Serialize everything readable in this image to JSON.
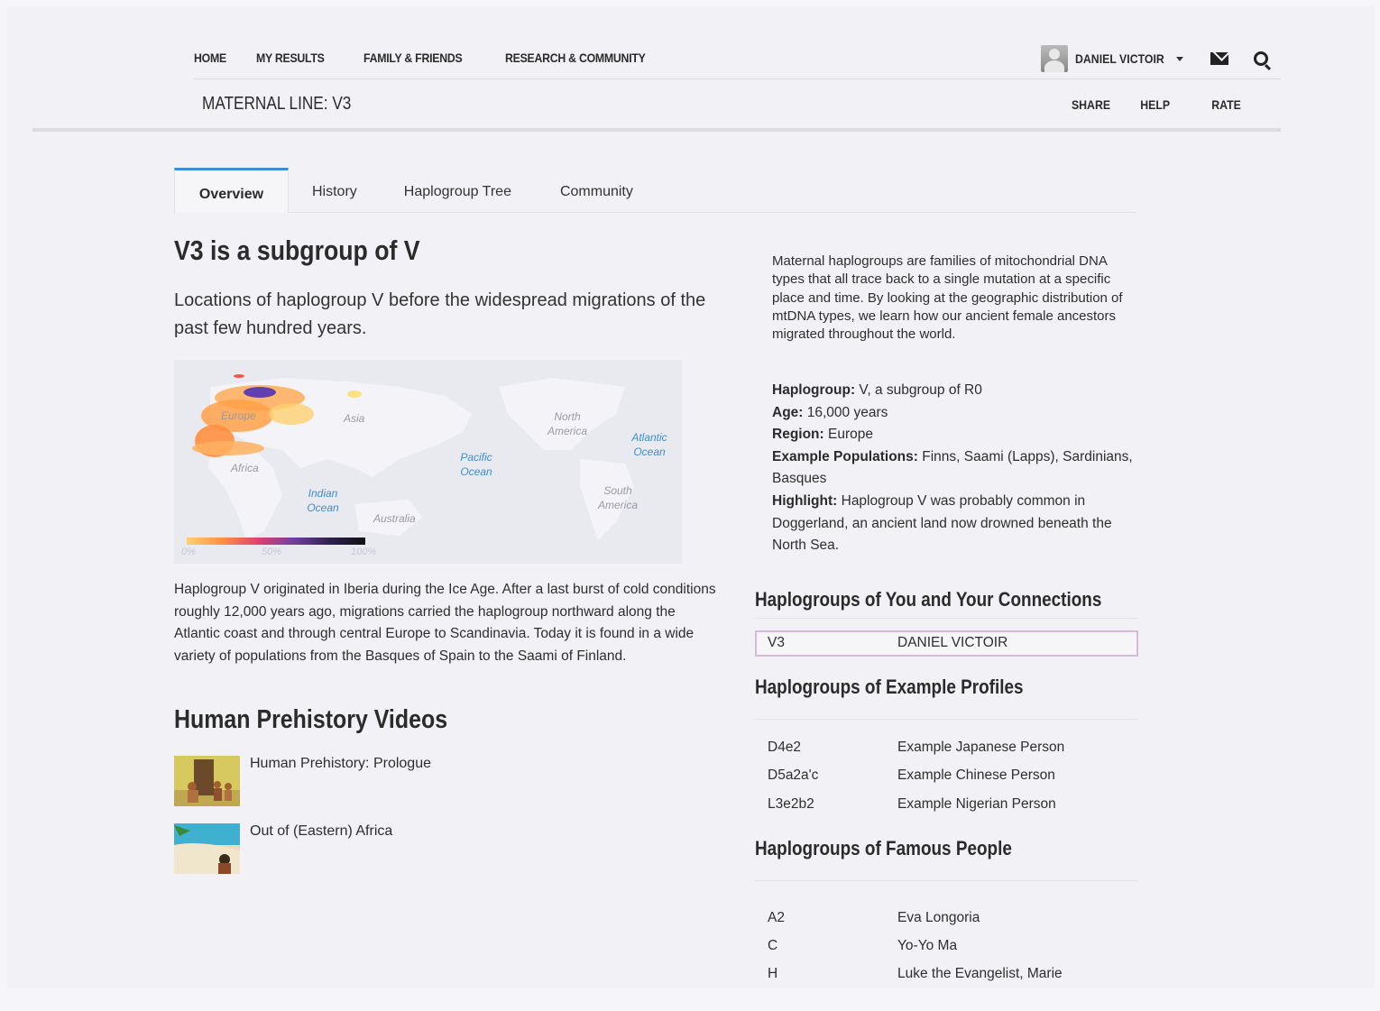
{
  "nav": {
    "items": [
      "HOME",
      "MY RESULTS",
      "FAMILY & FRIENDS",
      "RESEARCH & COMMUNITY"
    ],
    "user_name": "DANIEL VICTOIR"
  },
  "subbar": {
    "title": "MATERNAL LINE: V3",
    "links": [
      "SHARE",
      "HELP",
      "RATE"
    ]
  },
  "tabs": [
    "Overview",
    "History",
    "Haplogroup Tree",
    "Community"
  ],
  "main": {
    "heading": "V3 is a subgroup of V",
    "lead": "Locations of haplogroup V before the widespread migrations of the past few hundred years.",
    "map": {
      "labels": {
        "europe": "Europe",
        "asia": "Asia",
        "africa": "Africa",
        "australia": "Australia",
        "north_america": "North America",
        "south_america": "South America",
        "pacific": "Pacific Ocean",
        "atlantic": "Atlantic Ocean",
        "indian": "Indian Ocean"
      },
      "legend": [
        "0%",
        "50%",
        "100%"
      ]
    },
    "paragraph": "Haplogroup V originated in Iberia during the Ice Age. After a last burst of cold conditions roughly 12,000 years ago, migrations carried the haplogroup northward along the Atlantic coast and through central Europe to Scandinavia. Today it is found in a wide variety of populations from the Basques of Spain to the Saami of Finland.",
    "videos_heading": "Human Prehistory Videos",
    "videos": [
      {
        "title": "Human Prehistory: Prologue"
      },
      {
        "title": "Out of (Eastern) Africa"
      }
    ]
  },
  "side": {
    "description": "Maternal haplogroups are families of mitochondrial DNA types that all trace back to a single mutation at a specific place and time. By looking at the geographic distribution of mtDNA types, we learn how our ancient female ancestors migrated throughout the world.",
    "facts": {
      "haplogroup_label": "Haplogroup:",
      "haplogroup_value": " V, a subgroup of R0",
      "age_label": "Age:",
      "age_value": " 16,000 years",
      "region_label": "Region:",
      "region_value": " Europe",
      "populations_label": "Example Populations:",
      "populations_value": " Finns, Saami (Lapps), Sardinians, Basques",
      "highlight_label": "Highlight:",
      "highlight_value": " Haplogroup V was probably common in Doggerland, an ancient land now drowned beneath the North Sea."
    },
    "connections_heading": "Haplogroups of You and Your Connections",
    "connections": [
      {
        "code": "V3",
        "name": "DANIEL VICTOIR"
      }
    ],
    "examples_heading": "Haplogroups of Example Profiles",
    "examples": [
      {
        "code": "D4e2",
        "name": "Example Japanese Person"
      },
      {
        "code": "D5a2a'c",
        "name": "Example Chinese Person"
      },
      {
        "code": "L3e2b2",
        "name": "Example Nigerian Person"
      }
    ],
    "famous_heading": "Haplogroups of Famous People",
    "famous": [
      {
        "code": "A2",
        "name": "Eva Longoria"
      },
      {
        "code": "C",
        "name": "Yo-Yo Ma"
      },
      {
        "code": "H",
        "name": "Luke the Evangelist, Marie"
      }
    ]
  },
  "colors": {
    "accent": "#3a8fd6",
    "highlight_border": "#d8b9dc",
    "ocean_label": "#3b8fd0"
  }
}
